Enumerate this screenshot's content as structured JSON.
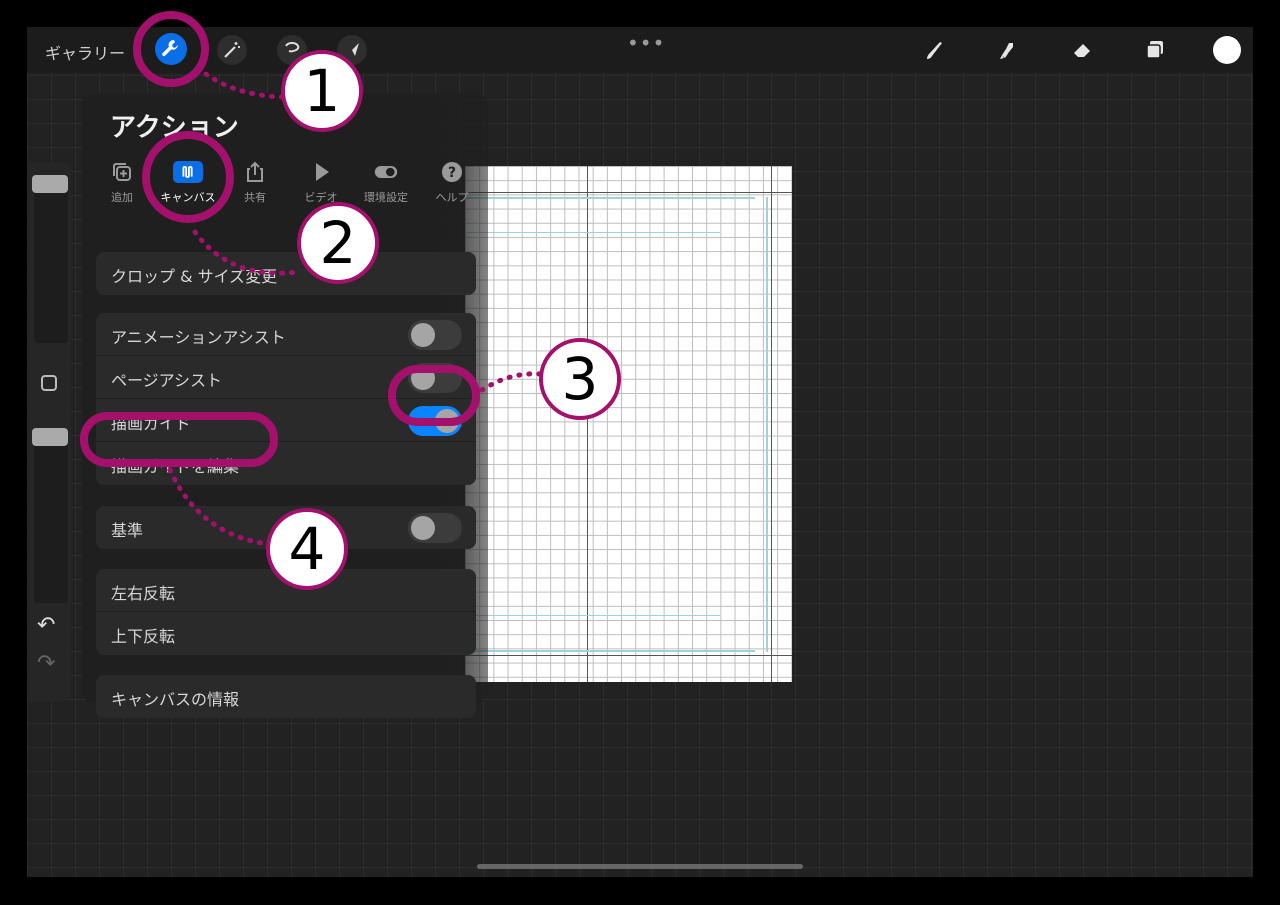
{
  "topbar": {
    "gallery_label": "ギャラリー",
    "more_dots": "•••",
    "icons": [
      "wrench-icon",
      "magic-wand-icon",
      "selection-icon",
      "transform-arrow-icon",
      "brush-icon",
      "smudge-icon",
      "eraser-icon",
      "layers-icon",
      "color-swatch"
    ]
  },
  "panel": {
    "title": "アクション",
    "tabs": [
      {
        "label": "追加",
        "icon": "add-icon"
      },
      {
        "label": "キャンバス",
        "icon": "canvas-icon",
        "active": true
      },
      {
        "label": "共有",
        "icon": "share-icon"
      },
      {
        "label": "ビデオ",
        "icon": "play-icon"
      },
      {
        "label": "環境設定",
        "icon": "prefs-toggle-icon"
      },
      {
        "label": "ヘルプ",
        "icon": "help-icon"
      }
    ],
    "items": {
      "crop": "クロップ & サイズ変更",
      "animation_assist": "アニメーションアシスト",
      "page_assist": "ページアシスト",
      "drawing_guide": "描画ガイド",
      "edit_drawing_guide": "描画ガイドを編集",
      "reference": "基準",
      "flip_h": "左右反転",
      "flip_v": "上下反転",
      "canvas_info": "キャンバスの情報"
    },
    "toggles": {
      "animation_assist": false,
      "page_assist": false,
      "drawing_guide": true,
      "reference": false
    }
  },
  "annotations": {
    "step1": "1",
    "step2": "2",
    "step3": "3",
    "step4": "4",
    "color": "#a4116d"
  },
  "colors": {
    "accent": "#0a6ee6",
    "toggle_on": "#0a84ff"
  }
}
